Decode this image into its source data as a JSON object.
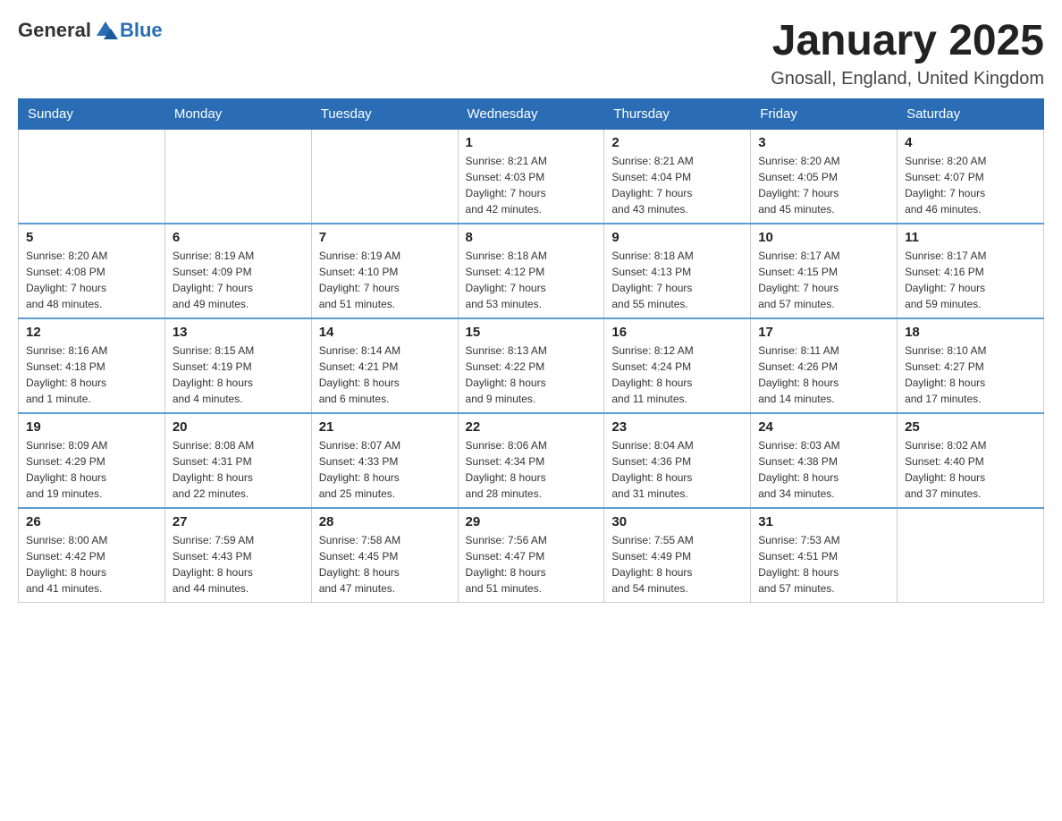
{
  "header": {
    "logo_general": "General",
    "logo_blue": "Blue",
    "month_title": "January 2025",
    "location": "Gnosall, England, United Kingdom"
  },
  "weekdays": [
    "Sunday",
    "Monday",
    "Tuesday",
    "Wednesday",
    "Thursday",
    "Friday",
    "Saturday"
  ],
  "weeks": [
    [
      {
        "day": "",
        "info": ""
      },
      {
        "day": "",
        "info": ""
      },
      {
        "day": "",
        "info": ""
      },
      {
        "day": "1",
        "info": "Sunrise: 8:21 AM\nSunset: 4:03 PM\nDaylight: 7 hours\nand 42 minutes."
      },
      {
        "day": "2",
        "info": "Sunrise: 8:21 AM\nSunset: 4:04 PM\nDaylight: 7 hours\nand 43 minutes."
      },
      {
        "day": "3",
        "info": "Sunrise: 8:20 AM\nSunset: 4:05 PM\nDaylight: 7 hours\nand 45 minutes."
      },
      {
        "day": "4",
        "info": "Sunrise: 8:20 AM\nSunset: 4:07 PM\nDaylight: 7 hours\nand 46 minutes."
      }
    ],
    [
      {
        "day": "5",
        "info": "Sunrise: 8:20 AM\nSunset: 4:08 PM\nDaylight: 7 hours\nand 48 minutes."
      },
      {
        "day": "6",
        "info": "Sunrise: 8:19 AM\nSunset: 4:09 PM\nDaylight: 7 hours\nand 49 minutes."
      },
      {
        "day": "7",
        "info": "Sunrise: 8:19 AM\nSunset: 4:10 PM\nDaylight: 7 hours\nand 51 minutes."
      },
      {
        "day": "8",
        "info": "Sunrise: 8:18 AM\nSunset: 4:12 PM\nDaylight: 7 hours\nand 53 minutes."
      },
      {
        "day": "9",
        "info": "Sunrise: 8:18 AM\nSunset: 4:13 PM\nDaylight: 7 hours\nand 55 minutes."
      },
      {
        "day": "10",
        "info": "Sunrise: 8:17 AM\nSunset: 4:15 PM\nDaylight: 7 hours\nand 57 minutes."
      },
      {
        "day": "11",
        "info": "Sunrise: 8:17 AM\nSunset: 4:16 PM\nDaylight: 7 hours\nand 59 minutes."
      }
    ],
    [
      {
        "day": "12",
        "info": "Sunrise: 8:16 AM\nSunset: 4:18 PM\nDaylight: 8 hours\nand 1 minute."
      },
      {
        "day": "13",
        "info": "Sunrise: 8:15 AM\nSunset: 4:19 PM\nDaylight: 8 hours\nand 4 minutes."
      },
      {
        "day": "14",
        "info": "Sunrise: 8:14 AM\nSunset: 4:21 PM\nDaylight: 8 hours\nand 6 minutes."
      },
      {
        "day": "15",
        "info": "Sunrise: 8:13 AM\nSunset: 4:22 PM\nDaylight: 8 hours\nand 9 minutes."
      },
      {
        "day": "16",
        "info": "Sunrise: 8:12 AM\nSunset: 4:24 PM\nDaylight: 8 hours\nand 11 minutes."
      },
      {
        "day": "17",
        "info": "Sunrise: 8:11 AM\nSunset: 4:26 PM\nDaylight: 8 hours\nand 14 minutes."
      },
      {
        "day": "18",
        "info": "Sunrise: 8:10 AM\nSunset: 4:27 PM\nDaylight: 8 hours\nand 17 minutes."
      }
    ],
    [
      {
        "day": "19",
        "info": "Sunrise: 8:09 AM\nSunset: 4:29 PM\nDaylight: 8 hours\nand 19 minutes."
      },
      {
        "day": "20",
        "info": "Sunrise: 8:08 AM\nSunset: 4:31 PM\nDaylight: 8 hours\nand 22 minutes."
      },
      {
        "day": "21",
        "info": "Sunrise: 8:07 AM\nSunset: 4:33 PM\nDaylight: 8 hours\nand 25 minutes."
      },
      {
        "day": "22",
        "info": "Sunrise: 8:06 AM\nSunset: 4:34 PM\nDaylight: 8 hours\nand 28 minutes."
      },
      {
        "day": "23",
        "info": "Sunrise: 8:04 AM\nSunset: 4:36 PM\nDaylight: 8 hours\nand 31 minutes."
      },
      {
        "day": "24",
        "info": "Sunrise: 8:03 AM\nSunset: 4:38 PM\nDaylight: 8 hours\nand 34 minutes."
      },
      {
        "day": "25",
        "info": "Sunrise: 8:02 AM\nSunset: 4:40 PM\nDaylight: 8 hours\nand 37 minutes."
      }
    ],
    [
      {
        "day": "26",
        "info": "Sunrise: 8:00 AM\nSunset: 4:42 PM\nDaylight: 8 hours\nand 41 minutes."
      },
      {
        "day": "27",
        "info": "Sunrise: 7:59 AM\nSunset: 4:43 PM\nDaylight: 8 hours\nand 44 minutes."
      },
      {
        "day": "28",
        "info": "Sunrise: 7:58 AM\nSunset: 4:45 PM\nDaylight: 8 hours\nand 47 minutes."
      },
      {
        "day": "29",
        "info": "Sunrise: 7:56 AM\nSunset: 4:47 PM\nDaylight: 8 hours\nand 51 minutes."
      },
      {
        "day": "30",
        "info": "Sunrise: 7:55 AM\nSunset: 4:49 PM\nDaylight: 8 hours\nand 54 minutes."
      },
      {
        "day": "31",
        "info": "Sunrise: 7:53 AM\nSunset: 4:51 PM\nDaylight: 8 hours\nand 57 minutes."
      },
      {
        "day": "",
        "info": ""
      }
    ]
  ]
}
